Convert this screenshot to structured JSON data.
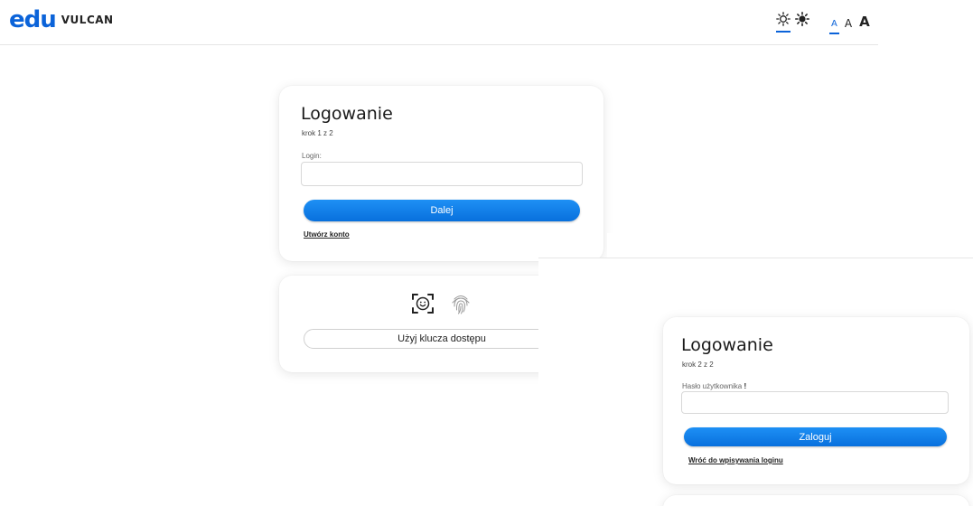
{
  "header": {
    "logo_mark": "edu",
    "logo_text": "VULCAN",
    "contrast_options": [
      {
        "icon": "sun-outline-icon",
        "active": true
      },
      {
        "icon": "sun-filled-icon",
        "active": false
      }
    ],
    "font_sizes": [
      "A",
      "A",
      "A"
    ]
  },
  "step1": {
    "title": "Logowanie",
    "step": "krok 1 z 2",
    "login_label": "Login:",
    "login_value": "",
    "next_button": "Dalej",
    "create_account_link": "Utwórz konto"
  },
  "passkey": {
    "icons": [
      "face-id-icon",
      "fingerprint-icon"
    ],
    "button": "Użyj klucza dostępu"
  },
  "step2": {
    "title": "Logowanie",
    "step": "krok 2 z 2",
    "password_label": "Hasło użytkownika",
    "required_marker": "!",
    "password_value": "",
    "login_button": "Zaloguj",
    "back_link": "Wróć do wpisywania loginu"
  },
  "colors": {
    "accent": "#0b63d9",
    "button_gradient_top": "#1e90f5",
    "button_gradient_bottom": "#0870dd"
  }
}
